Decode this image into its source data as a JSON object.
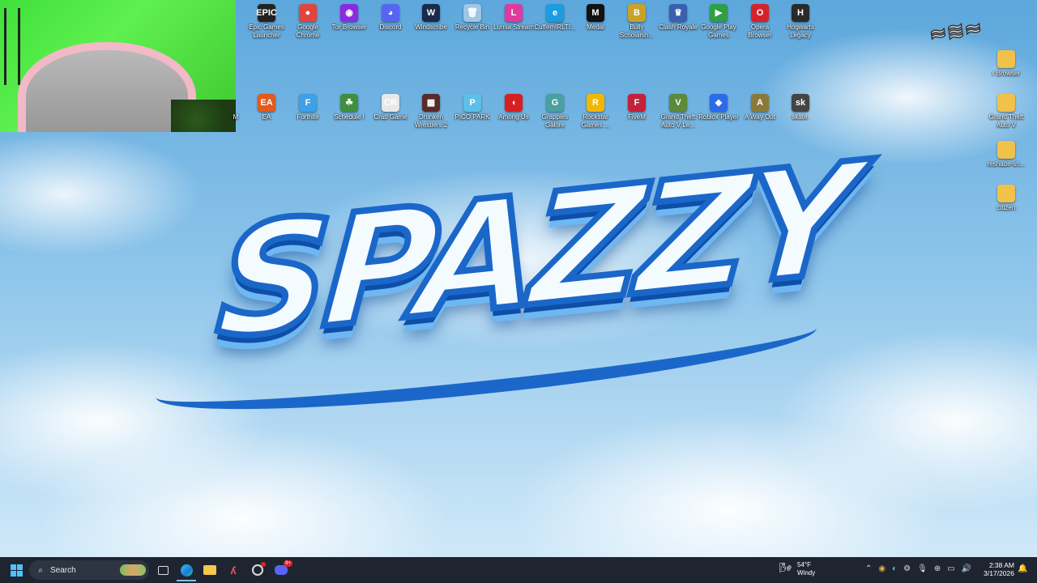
{
  "desktop": {
    "logo_text": "SPAZZY",
    "top_row": [
      {
        "label": "Epic Games Launcher",
        "glyph": "EPIC",
        "color": "#222222",
        "icon": "epic-games-icon"
      },
      {
        "label": "Google Chrome",
        "glyph": "●",
        "color": "#e0463c",
        "icon": "chrome-icon"
      },
      {
        "label": "Tor Browser",
        "glyph": "◉",
        "color": "#8a2be2",
        "icon": "tor-browser-icon"
      },
      {
        "label": "Discord",
        "glyph": "◕",
        "color": "#5865f2",
        "icon": "discord-icon"
      },
      {
        "label": "Windscribe",
        "glyph": "W",
        "color": "#1a2a4a",
        "icon": "windscribe-icon"
      },
      {
        "label": "Recycle Bin",
        "glyph": "🗑",
        "color": "#9fc6e6",
        "icon": "recycle-bin-icon"
      },
      {
        "label": "Lumia Stream",
        "glyph": "L",
        "color": "#e03aa0",
        "icon": "lumia-stream-icon"
      },
      {
        "label": "CuffemIRLTI...",
        "glyph": "e",
        "color": "#1b9de2",
        "icon": "edge-shortcut-icon"
      },
      {
        "label": "Medal",
        "glyph": "M",
        "color": "#111111",
        "icon": "medal-icon"
      },
      {
        "label": "Bully Scholarsh...",
        "glyph": "B",
        "color": "#c9a227",
        "icon": "bully-icon"
      },
      {
        "label": "Clash Royale",
        "glyph": "♛",
        "color": "#3a5fb0",
        "icon": "clash-royale-icon"
      },
      {
        "label": "Google Play Games",
        "glyph": "▶",
        "color": "#2f9e44",
        "icon": "google-play-games-icon"
      },
      {
        "label": "Opera Browser",
        "glyph": "O",
        "color": "#d6212b",
        "icon": "opera-icon"
      },
      {
        "label": "Hogwarts Legacy",
        "glyph": "H",
        "color": "#2a2a2a",
        "icon": "hogwarts-legacy-icon"
      }
    ],
    "second_row": [
      {
        "label": "EA",
        "glyph": "EA",
        "color": "#e25a1c",
        "icon": "ea-icon"
      },
      {
        "label": "Fortnite",
        "glyph": "F",
        "color": "#3ea0e8",
        "icon": "fortnite-icon"
      },
      {
        "label": "Schedule I",
        "glyph": "☘",
        "color": "#3f8f3f",
        "icon": "schedule-i-icon"
      },
      {
        "label": "Crab Game",
        "glyph": "CR",
        "color": "#e8e8e8",
        "icon": "crab-game-icon"
      },
      {
        "label": "Drunken Wrestlers 2",
        "glyph": "▦",
        "color": "#5a2a2a",
        "icon": "drunken-wrestlers-icon"
      },
      {
        "label": "PICO PARK",
        "glyph": "P",
        "color": "#5cc0e8",
        "icon": "pico-park-icon"
      },
      {
        "label": "Among Us",
        "glyph": "◖",
        "color": "#d62020",
        "icon": "among-us-icon"
      },
      {
        "label": "Grapples Galore",
        "glyph": "G",
        "color": "#4aa0a0",
        "icon": "grapples-galore-icon"
      },
      {
        "label": "Rockstar Games ...",
        "glyph": "R",
        "color": "#f2b705",
        "icon": "rockstar-icon"
      },
      {
        "label": "FiveM",
        "glyph": "F",
        "color": "#c4213a",
        "icon": "fivem-icon"
      },
      {
        "label": "Grand Theft Auto V Le...",
        "glyph": "V",
        "color": "#5a8a3a",
        "icon": "gta-v-legacy-icon"
      },
      {
        "label": "Roblox Player",
        "glyph": "◆",
        "color": "#2b6be8",
        "icon": "roblox-icon"
      },
      {
        "label": "A Way Out",
        "glyph": "A",
        "color": "#8a7a3a",
        "icon": "a-way-out-icon"
      },
      {
        "label": "skate.",
        "glyph": "sk",
        "color": "#444444",
        "icon": "skate-icon"
      }
    ],
    "left_partial_label": "M",
    "right_column": [
      {
        "label": "r Browser",
        "glyph": "",
        "color": "#f0c24a",
        "icon": "folder-icon"
      },
      {
        "label": "Grand Theft Auto V",
        "glyph": "",
        "color": "#f0c24a",
        "icon": "folder-icon"
      },
      {
        "label": "reshade-sh...",
        "glyph": "",
        "color": "#f0c24a",
        "icon": "folder-icon"
      },
      {
        "label": "citizen",
        "glyph": "",
        "color": "#f0c24a",
        "icon": "folder-icon"
      }
    ]
  },
  "taskbar": {
    "search_label": "Search",
    "weather_temp": "54°F",
    "weather_desc": "Windy",
    "time": "2:38 AM",
    "date": "3/17/2026",
    "discord_badge": "9+"
  }
}
